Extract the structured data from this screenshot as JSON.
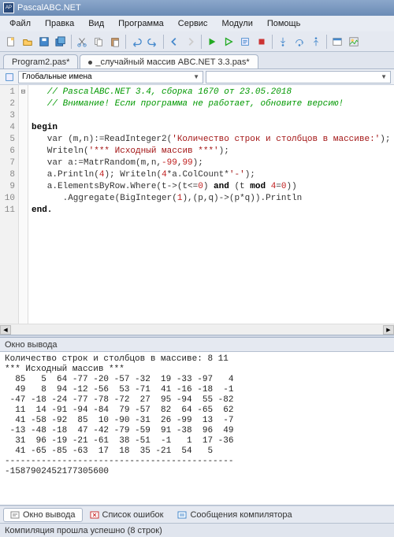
{
  "titlebar": {
    "appname": "PascalABC.NET"
  },
  "menu": {
    "file": "Файл",
    "edit": "Правка",
    "view": "Вид",
    "program": "Программа",
    "service": "Сервис",
    "modules": "Модули",
    "help": "Помощь"
  },
  "tabs": [
    {
      "label": "Program2.pas*"
    },
    {
      "label": "_случайный массив ABC.NET 3.3.pas*"
    }
  ],
  "subbar": {
    "combo_label": "Глобальные имена"
  },
  "gutter_lines": [
    "1",
    "2",
    "3",
    "4",
    "5",
    "6",
    "7",
    "8",
    "9",
    "10",
    "11"
  ],
  "fold_marks": [
    "",
    "",
    "",
    "⊟",
    "",
    "",
    "",
    "",
    "",
    "",
    ""
  ],
  "code": {
    "l1": "   // PascalABC.NET 3.4, сборка 1670 от 23.05.2018",
    "l2": "   // Внимание! Если программа не работает, обновите версию!",
    "l3": "",
    "l4_kw": "begin",
    "l5a": "   var (m,n):=ReadInteger2(",
    "l5s": "'Количество строк и столбцов в массиве:'",
    "l5b": ");",
    "l6a": "   Writeln(",
    "l6s": "'*** Исходный массив ***'",
    "l6b": ");",
    "l7a": "   var a:=MatrRandom(m,n,",
    "l7n1": "-99",
    "l7c": ",",
    "l7n2": "99",
    "l7b": ");",
    "l8a": "   a.Println(",
    "l8n": "4",
    "l8b": "); Writeln(",
    "l8n2": "4",
    "l8c": "*a.ColCount*",
    "l8s": "'-'",
    "l8d": ");",
    "l9a": "   a.ElementsByRow.Where(t->(t<=",
    "l9n1": "0",
    "l9b": ") ",
    "l9kw": "and",
    "l9c": " (t ",
    "l9kw2": "mod",
    "l9d": " ",
    "l9n2": "4",
    "l9e": "=",
    "l9n3": "0",
    "l9f": "))",
    "l10a": "      .Aggregate(BigInteger(",
    "l10n": "1",
    "l10b": "),(p,q)->(p*q)).Println",
    "l11": "end."
  },
  "output_header": "Окно вывода",
  "output_text": "Количество строк и столбцов в массиве: 8 11\n*** Исходный массив ***\n  85   5  64 -77 -20 -57 -32  19 -33 -97   4\n  49   8  94 -12 -56  53 -71  41 -16 -18  -1\n -47 -18 -24 -77 -78 -72  27  95 -94  55 -82\n  11  14 -91 -94 -84  79 -57  82  64 -65  62\n  41 -58 -92  85  10 -90 -31  26 -99  13  -7\n -13 -48 -18  47 -42 -79 -59  91 -38  96  49\n  31  96 -19 -21 -61  38 -51  -1   1  17 -36\n  41 -65 -85 -63  17  18  35 -21  54   5\n--------------------------------------------\n-1587902452177305600\n",
  "bottom_tabs": {
    "output": "Окно вывода",
    "errors": "Список ошибок",
    "compiler": "Сообщения компилятора"
  },
  "statusbar": {
    "text": "Компиляция прошла успешно (8 строк)"
  }
}
